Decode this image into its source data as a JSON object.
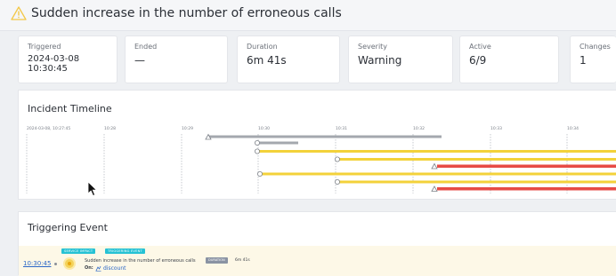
{
  "header": {
    "title": "Sudden increase in the number of erroneous calls",
    "icon": "warning-triangle-icon"
  },
  "stats": [
    {
      "label": "Triggered",
      "value_line1": "2024-03-08",
      "value_line2": "10:30:45"
    },
    {
      "label": "Ended",
      "value": "—"
    },
    {
      "label": "Duration",
      "value": "6m 41s"
    },
    {
      "label": "Severity",
      "value": "Warning"
    },
    {
      "label": "Active",
      "value": "6/9"
    },
    {
      "label": "Changes",
      "value": "1"
    }
  ],
  "timeline": {
    "title": "Incident Timeline",
    "ticks": [
      "2024-03-08, 10:27:45",
      "10:28",
      "10:29",
      "10:30",
      "10:31",
      "10:32",
      "10:33",
      "10:34"
    ],
    "colors": {
      "gray": "#a4a8ae",
      "warning": "#f3d23a",
      "critical": "#e74b45"
    }
  },
  "trigger": {
    "title": "Triggering Event",
    "time": "10:30:45",
    "badges": [
      "SERVICE IMPACT",
      "TRIGGERING EVENT"
    ],
    "event_text": "Sudden increase in the number of erroneous calls",
    "duration_label": "DURATION",
    "duration_value": "6m 41s",
    "on_label": "On:",
    "entity": "discount",
    "entity_icon": "service-icon"
  }
}
